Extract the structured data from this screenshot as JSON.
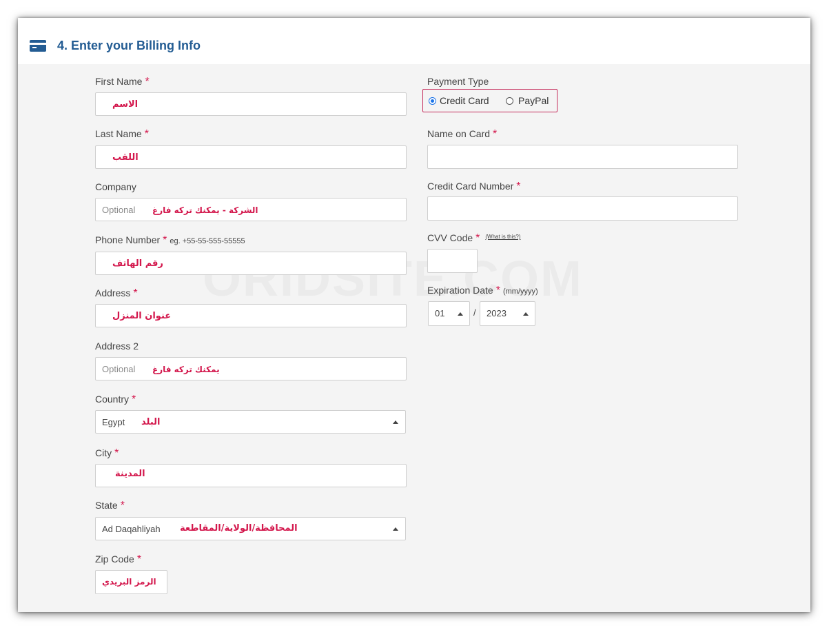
{
  "header": {
    "title": "4. Enter your Billing Info",
    "icon": "credit-card-icon"
  },
  "watermark": "ORIDSITE.COM",
  "required_mark": "*",
  "billing": {
    "first_name": {
      "label": "First Name",
      "value": "",
      "annotation": "الاسم"
    },
    "last_name": {
      "label": "Last Name",
      "value": "",
      "annotation": "اللقب"
    },
    "company": {
      "label": "Company",
      "placeholder": "Optional",
      "annotation": "الشركة - يمكنك تركه فارغ"
    },
    "phone": {
      "label": "Phone Number",
      "hint": "eg. +55-55-555-55555",
      "annotation": "رقم الهاتف"
    },
    "address": {
      "label": "Address",
      "annotation": "عنوان المنزل"
    },
    "address2": {
      "label": "Address 2",
      "placeholder": "Optional",
      "annotation": "يمكنك تركه فارغ"
    },
    "country": {
      "label": "Country",
      "value": "Egypt",
      "annotation": "البلد"
    },
    "city": {
      "label": "City",
      "annotation": "المدينة"
    },
    "state": {
      "label": "State",
      "value": "Ad Daqahliyah",
      "annotation": "المحافظة/الولاية/المقاطعة"
    },
    "zip": {
      "label": "Zip Code",
      "annotation": "الرمز البريدي"
    }
  },
  "payment": {
    "type_label": "Payment Type",
    "options": [
      "Credit Card",
      "PayPal"
    ],
    "selected": "Credit Card",
    "name_on_card": {
      "label": "Name on Card"
    },
    "card_number": {
      "label": "Credit Card Number"
    },
    "cvv": {
      "label": "CVV Code",
      "help_link": "(What is this?)"
    },
    "expiration": {
      "label": "Expiration Date",
      "hint": "(mm/yyyy)",
      "month": "01",
      "separator": "/",
      "year": "2023"
    }
  },
  "colors": {
    "accent": "#235c93",
    "required": "#d3174c",
    "annotation": "#d3174c",
    "highlight_border": "#c42a5a"
  }
}
